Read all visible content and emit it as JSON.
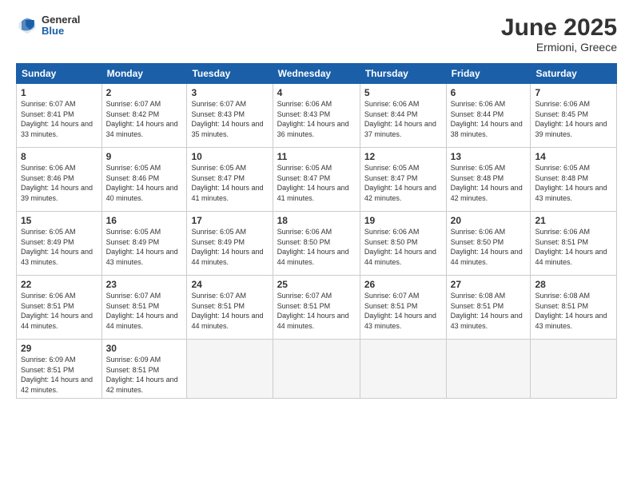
{
  "header": {
    "logo_general": "General",
    "logo_blue": "Blue",
    "title": "June 2025",
    "subtitle": "Ermioni, Greece"
  },
  "columns": [
    "Sunday",
    "Monday",
    "Tuesday",
    "Wednesday",
    "Thursday",
    "Friday",
    "Saturday"
  ],
  "weeks": [
    [
      {
        "day": "1",
        "sunrise": "6:07 AM",
        "sunset": "8:41 PM",
        "daylight": "14 hours and 33 minutes."
      },
      {
        "day": "2",
        "sunrise": "6:07 AM",
        "sunset": "8:42 PM",
        "daylight": "14 hours and 34 minutes."
      },
      {
        "day": "3",
        "sunrise": "6:07 AM",
        "sunset": "8:43 PM",
        "daylight": "14 hours and 35 minutes."
      },
      {
        "day": "4",
        "sunrise": "6:06 AM",
        "sunset": "8:43 PM",
        "daylight": "14 hours and 36 minutes."
      },
      {
        "day": "5",
        "sunrise": "6:06 AM",
        "sunset": "8:44 PM",
        "daylight": "14 hours and 37 minutes."
      },
      {
        "day": "6",
        "sunrise": "6:06 AM",
        "sunset": "8:44 PM",
        "daylight": "14 hours and 38 minutes."
      },
      {
        "day": "7",
        "sunrise": "6:06 AM",
        "sunset": "8:45 PM",
        "daylight": "14 hours and 39 minutes."
      }
    ],
    [
      {
        "day": "8",
        "sunrise": "6:06 AM",
        "sunset": "8:46 PM",
        "daylight": "14 hours and 39 minutes."
      },
      {
        "day": "9",
        "sunrise": "6:05 AM",
        "sunset": "8:46 PM",
        "daylight": "14 hours and 40 minutes."
      },
      {
        "day": "10",
        "sunrise": "6:05 AM",
        "sunset": "8:47 PM",
        "daylight": "14 hours and 41 minutes."
      },
      {
        "day": "11",
        "sunrise": "6:05 AM",
        "sunset": "8:47 PM",
        "daylight": "14 hours and 41 minutes."
      },
      {
        "day": "12",
        "sunrise": "6:05 AM",
        "sunset": "8:47 PM",
        "daylight": "14 hours and 42 minutes."
      },
      {
        "day": "13",
        "sunrise": "6:05 AM",
        "sunset": "8:48 PM",
        "daylight": "14 hours and 42 minutes."
      },
      {
        "day": "14",
        "sunrise": "6:05 AM",
        "sunset": "8:48 PM",
        "daylight": "14 hours and 43 minutes."
      }
    ],
    [
      {
        "day": "15",
        "sunrise": "6:05 AM",
        "sunset": "8:49 PM",
        "daylight": "14 hours and 43 minutes."
      },
      {
        "day": "16",
        "sunrise": "6:05 AM",
        "sunset": "8:49 PM",
        "daylight": "14 hours and 43 minutes."
      },
      {
        "day": "17",
        "sunrise": "6:05 AM",
        "sunset": "8:49 PM",
        "daylight": "14 hours and 44 minutes."
      },
      {
        "day": "18",
        "sunrise": "6:06 AM",
        "sunset": "8:50 PM",
        "daylight": "14 hours and 44 minutes."
      },
      {
        "day": "19",
        "sunrise": "6:06 AM",
        "sunset": "8:50 PM",
        "daylight": "14 hours and 44 minutes."
      },
      {
        "day": "20",
        "sunrise": "6:06 AM",
        "sunset": "8:50 PM",
        "daylight": "14 hours and 44 minutes."
      },
      {
        "day": "21",
        "sunrise": "6:06 AM",
        "sunset": "8:51 PM",
        "daylight": "14 hours and 44 minutes."
      }
    ],
    [
      {
        "day": "22",
        "sunrise": "6:06 AM",
        "sunset": "8:51 PM",
        "daylight": "14 hours and 44 minutes."
      },
      {
        "day": "23",
        "sunrise": "6:07 AM",
        "sunset": "8:51 PM",
        "daylight": "14 hours and 44 minutes."
      },
      {
        "day": "24",
        "sunrise": "6:07 AM",
        "sunset": "8:51 PM",
        "daylight": "14 hours and 44 minutes."
      },
      {
        "day": "25",
        "sunrise": "6:07 AM",
        "sunset": "8:51 PM",
        "daylight": "14 hours and 44 minutes."
      },
      {
        "day": "26",
        "sunrise": "6:07 AM",
        "sunset": "8:51 PM",
        "daylight": "14 hours and 43 minutes."
      },
      {
        "day": "27",
        "sunrise": "6:08 AM",
        "sunset": "8:51 PM",
        "daylight": "14 hours and 43 minutes."
      },
      {
        "day": "28",
        "sunrise": "6:08 AM",
        "sunset": "8:51 PM",
        "daylight": "14 hours and 43 minutes."
      }
    ],
    [
      {
        "day": "29",
        "sunrise": "6:09 AM",
        "sunset": "8:51 PM",
        "daylight": "14 hours and 42 minutes."
      },
      {
        "day": "30",
        "sunrise": "6:09 AM",
        "sunset": "8:51 PM",
        "daylight": "14 hours and 42 minutes."
      },
      null,
      null,
      null,
      null,
      null
    ]
  ]
}
